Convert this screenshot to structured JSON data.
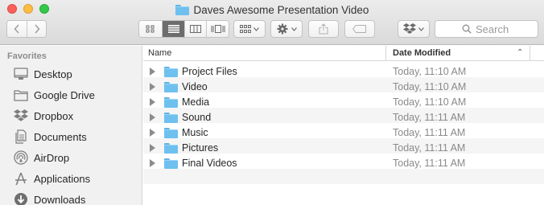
{
  "window": {
    "title": "Daves Awesome Presentation Video"
  },
  "toolbar": {
    "back_icon": "chevron-left-icon",
    "forward_icon": "chevron-right-icon",
    "view_modes": [
      {
        "name": "icon-view",
        "active": false
      },
      {
        "name": "list-view",
        "active": true
      },
      {
        "name": "column-view",
        "active": false
      },
      {
        "name": "cover-flow-view",
        "active": false
      }
    ],
    "search_placeholder": "Search"
  },
  "sidebar": {
    "heading": "Favorites",
    "items": [
      {
        "label": "Desktop",
        "icon": "desktop-icon"
      },
      {
        "label": "Google Drive",
        "icon": "folder-icon"
      },
      {
        "label": "Dropbox",
        "icon": "dropbox-icon"
      },
      {
        "label": "Documents",
        "icon": "documents-icon"
      },
      {
        "label": "AirDrop",
        "icon": "airdrop-icon"
      },
      {
        "label": "Applications",
        "icon": "applications-icon"
      },
      {
        "label": "Downloads",
        "icon": "downloads-icon"
      }
    ]
  },
  "list": {
    "columns": {
      "name": "Name",
      "date": "Date Modified",
      "sort": "ascending"
    },
    "rows": [
      {
        "name": "Project Files",
        "date": "Today, 11:10 AM"
      },
      {
        "name": "Video",
        "date": "Today, 11:10 AM"
      },
      {
        "name": "Media",
        "date": "Today, 11:10 AM"
      },
      {
        "name": "Sound",
        "date": "Today, 11:11 AM"
      },
      {
        "name": "Music",
        "date": "Today, 11:11 AM"
      },
      {
        "name": "Pictures",
        "date": "Today, 11:11 AM"
      },
      {
        "name": "Final Videos",
        "date": "Today, 11:11 AM"
      }
    ]
  },
  "colors": {
    "folder": "#6ec0ef",
    "row_stripe": "#f5f5f5",
    "sidebar_bg": "#f1f1f1",
    "active_segment": "#6d6d6d",
    "close": "#fc605c",
    "minimize": "#fdbc40",
    "maximize": "#34c84a"
  }
}
